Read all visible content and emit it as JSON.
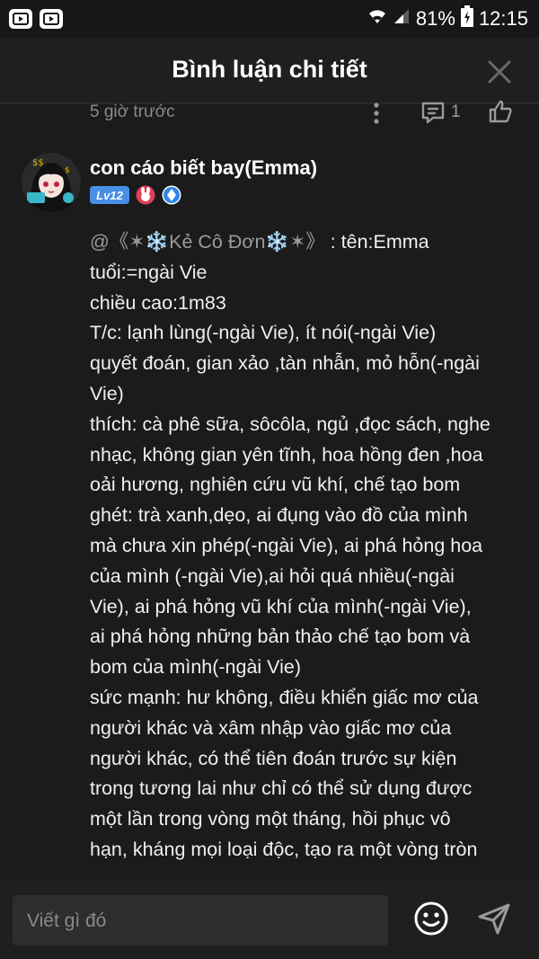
{
  "status_bar": {
    "battery": "81%",
    "time": "12:15"
  },
  "header": {
    "title": "Bình luận chi tiết"
  },
  "previous_comment": {
    "time": "5 giờ trước",
    "reply_count": "1"
  },
  "comment": {
    "username": "con cáo biết bay(Emma)",
    "level": "Lv12",
    "mention": "@《✶❄️Kẻ Cô Đơn❄️✶》",
    "lines": [
      " : tên:Emma",
      "tuổi:=ngài Vie",
      "chiều cao:1m83",
      "T/c: lạnh lùng(-ngài Vie), ít nói(-ngài Vie)",
      "quyết đoán, gian xảo ,tàn nhẫn, mỏ hỗn(-ngài",
      "Vie)",
      "thích: cà phê sữa, sôcôla, ngủ ,đọc sách, nghe",
      "nhạc, không gian yên tĩnh, hoa hồng đen ,hoa",
      "oải hương, nghiên cứu vũ khí, chế tạo bom",
      "ghét: trà xanh,dẹo, ai đụng vào đồ của mình",
      "mà chưa xin phép(-ngài Vie), ai phá hỏng hoa",
      "của mình (-ngài Vie),ai hỏi quá nhiều(-ngài",
      "Vie), ai phá hỏng vũ khí của mình(-ngài Vie),",
      "ai phá hỏng những bản thảo chế tạo bom và",
      "bom của mình(-ngài Vie)",
      "sức mạnh: hư không, điều khiển giấc mơ của",
      "người khác và xâm nhập vào giấc mơ của",
      "người khác, có thể tiên đoán trước sự kiện",
      "trong tương lai như chỉ có thể sử dụng được",
      "một lần trong vòng một tháng, hồi phục vô",
      "hạn, kháng mọi loại độc, tạo ra một vòng tròn"
    ]
  },
  "input": {
    "placeholder": "Viết gì đó"
  },
  "colors": {
    "background": "#1b1b1b",
    "text": "#f0f0f0",
    "muted": "#8a8a8a",
    "level_badge": "#4a8fe6"
  },
  "icons": [
    "app-icon",
    "wifi-icon",
    "signal-icon",
    "battery-icon",
    "close-icon",
    "more-icon",
    "reply-icon",
    "like-icon",
    "emoji-icon",
    "send-icon"
  ]
}
